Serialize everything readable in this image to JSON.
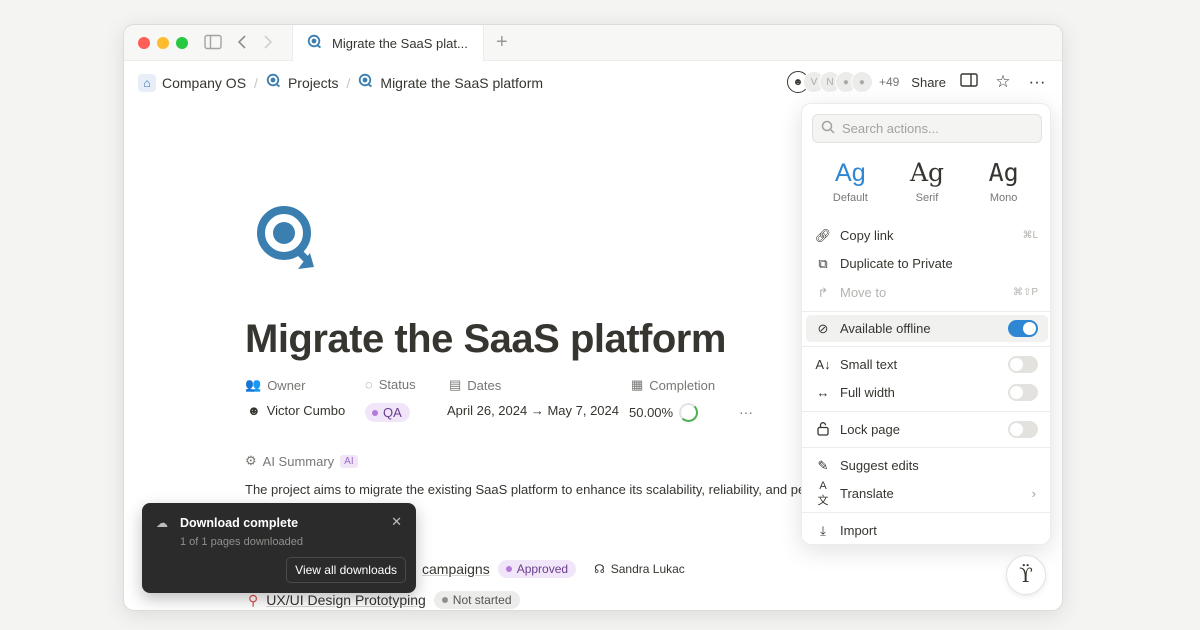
{
  "browser": {
    "tab_title": "Migrate the SaaS plat...",
    "new_tab_icon": "plus-icon"
  },
  "breadcrumb": [
    {
      "label": "Company OS",
      "icon": "home-icon"
    },
    {
      "label": "Projects",
      "icon": "project-icon"
    },
    {
      "label": "Migrate the SaaS platform",
      "icon": "project-icon"
    }
  ],
  "topbar": {
    "avatar_more": "+49",
    "share_label": "Share"
  },
  "page": {
    "title": "Migrate the SaaS platform",
    "properties": {
      "owner_label": "Owner",
      "owner_value": "Victor Cumbo",
      "status_label": "Status",
      "status_value": "QA",
      "dates_label": "Dates",
      "dates_value": "April 26, 2024 → May 7, 2024",
      "completion_label": "Completion",
      "completion_value": "50.00%",
      "completion_fraction": 0.5
    },
    "ai_summary_label": "AI Summary",
    "ai_badge": "AI",
    "summary_text": "The project aims to migrate the existing SaaS platform to enhance its scalability, reliability, and perform",
    "tasks": [
      {
        "title": "campaigns",
        "status": "Approved",
        "assignee": "Sandra Lukac"
      },
      {
        "title": "UX/UI Design Prototyping",
        "status": "Not started",
        "assignee": ""
      }
    ]
  },
  "toast": {
    "title": "Download complete",
    "subtitle": "1 of 1 pages downloaded",
    "button": "View all downloads"
  },
  "menu": {
    "search_placeholder": "Search actions...",
    "fonts": [
      {
        "sample": "Ag",
        "label": "Default",
        "active": true
      },
      {
        "sample": "Ag",
        "label": "Serif",
        "active": false
      },
      {
        "sample": "Ag",
        "label": "Mono",
        "active": false
      }
    ],
    "items": {
      "copy_link": {
        "label": "Copy link",
        "shortcut": "⌘L"
      },
      "duplicate": {
        "label": "Duplicate to Private"
      },
      "move_to": {
        "label": "Move to",
        "shortcut": "⌘⇧P"
      },
      "available_offline": {
        "label": "Available offline",
        "on": true
      },
      "small_text": {
        "label": "Small text",
        "on": false
      },
      "full_width": {
        "label": "Full width",
        "on": false
      },
      "lock_page": {
        "label": "Lock page",
        "on": false
      },
      "suggest_edits": {
        "label": "Suggest edits"
      },
      "translate": {
        "label": "Translate"
      },
      "import": {
        "label": "Import"
      }
    }
  },
  "colors": {
    "accent": "#2f86d2",
    "page_icon": "#3a7fb0",
    "toast_bg": "#2b2b2b"
  }
}
